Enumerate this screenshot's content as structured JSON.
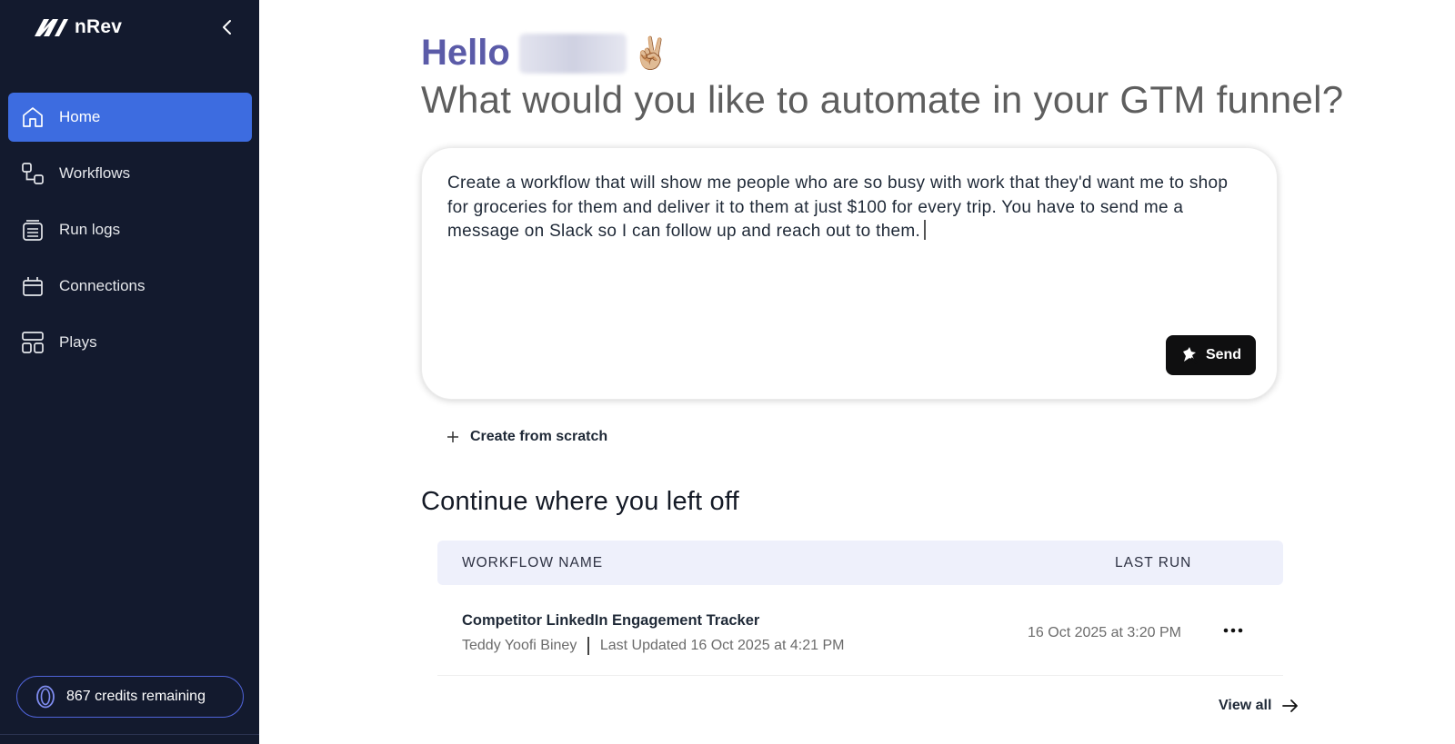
{
  "app": {
    "brand_name": "nRev",
    "accent_color": "#3d6ce0",
    "sidebar_color": "#131a2e"
  },
  "sidebar": {
    "items": [
      {
        "label": "Home",
        "icon": "home-icon",
        "active": true
      },
      {
        "label": "Workflows",
        "icon": "workflows-icon",
        "active": false
      },
      {
        "label": "Run logs",
        "icon": "run-logs-icon",
        "active": false
      },
      {
        "label": "Connections",
        "icon": "connections-icon",
        "active": false
      },
      {
        "label": "Plays",
        "icon": "plays-icon",
        "active": false
      }
    ],
    "credits_label": "867 credits remaining"
  },
  "greeting": {
    "hello": "Hello",
    "emoji": "✌🏼",
    "subtitle": "What would you like to automate in your GTM funnel?"
  },
  "prompt": {
    "text": "Create a workflow that will show me people who are so busy with work that they'd want me to shop for groceries for them and deliver it to them at just $100 for every trip. You have to send me a message on Slack so I can follow up and reach out to them.",
    "send_label": "Send"
  },
  "create_scratch_label": "Create from scratch",
  "continue_section": {
    "title": "Continue where you left off",
    "columns": {
      "name": "WORKFLOW NAME",
      "last_run": "LAST RUN"
    },
    "rows": [
      {
        "name": "Competitor LinkedIn Engagement Tracker",
        "owner": "Teddy Yoofi Biney",
        "updated": "Last Updated 16 Oct 2025 at 4:21 PM",
        "last_run": "16 Oct 2025 at 3:20 PM"
      }
    ],
    "view_all_label": "View all"
  }
}
